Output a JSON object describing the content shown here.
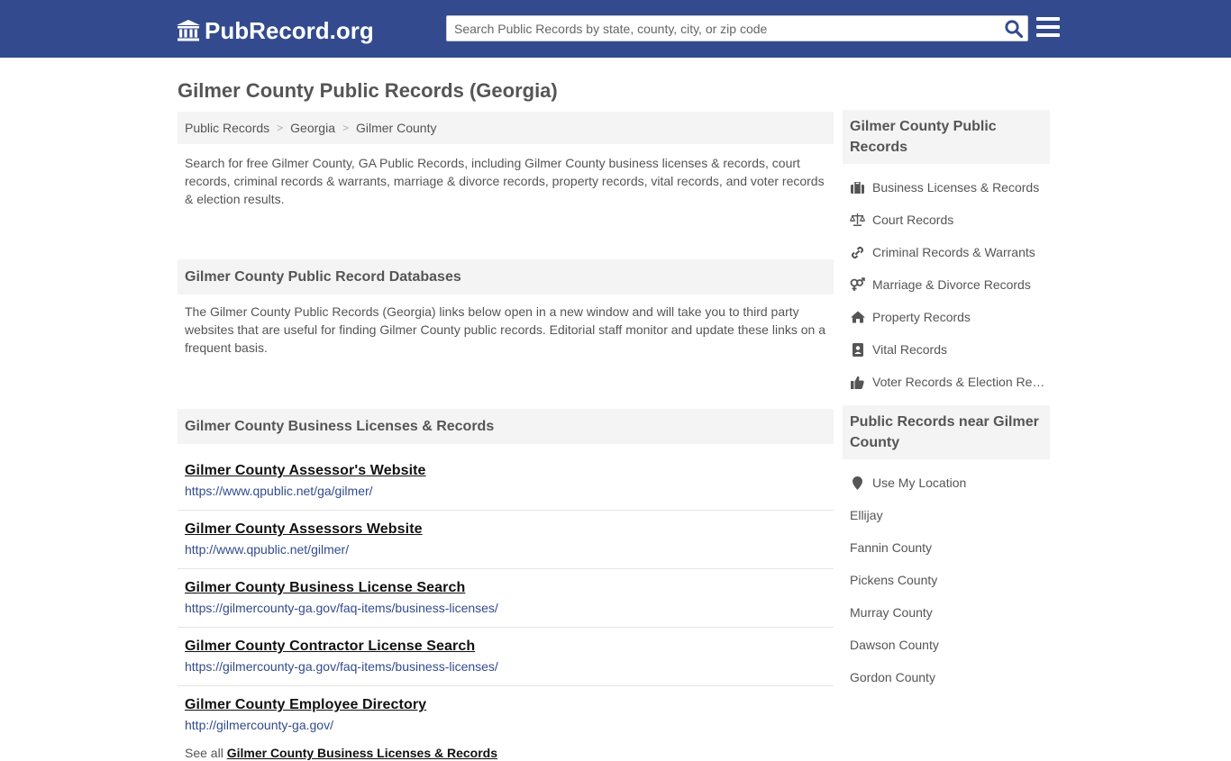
{
  "header": {
    "logo_text": "PubRecord.org",
    "search_placeholder": "Search Public Records by state, county, city, or zip code"
  },
  "page_title": "Gilmer County Public Records (Georgia)",
  "breadcrumb": [
    "Public Records",
    "Georgia",
    "Gilmer County"
  ],
  "intro": "Search for free Gilmer County, GA Public Records, including Gilmer County business licenses & records, court records, criminal records & warrants, marriage & divorce records, property records, vital records, and voter records & election results.",
  "databases": {
    "heading": "Gilmer County Public Record Databases",
    "description": "The Gilmer County Public Records (Georgia) links below open in a new window and will take you to third party websites that are useful for finding Gilmer County public records. Editorial staff monitor and update these links on a frequent basis."
  },
  "business": {
    "heading": "Gilmer County Business Licenses & Records",
    "records": [
      {
        "title": "Gilmer County Assessor's Website",
        "url": "https://www.qpublic.net/ga/gilmer/"
      },
      {
        "title": "Gilmer County Assessors Website",
        "url": "http://www.qpublic.net/gilmer/"
      },
      {
        "title": "Gilmer County Business License Search",
        "url": "https://gilmercounty-ga.gov/faq-items/business-licenses/"
      },
      {
        "title": "Gilmer County Contractor License Search",
        "url": "https://gilmercounty-ga.gov/faq-items/business-licenses/"
      },
      {
        "title": "Gilmer County Employee Directory",
        "url": "http://gilmercounty-ga.gov/"
      }
    ],
    "see_all_prefix": "See all",
    "see_all_link": "Gilmer County Business Licenses & Records"
  },
  "sidebar": {
    "records_heading": "Gilmer County Public Records",
    "records_links": [
      {
        "label": "Business Licenses & Records",
        "icon": "briefcase-icon"
      },
      {
        "label": "Court Records",
        "icon": "scales-icon"
      },
      {
        "label": "Criminal Records & Warrants",
        "icon": "link-icon"
      },
      {
        "label": "Marriage & Divorce Records",
        "icon": "gender-icon"
      },
      {
        "label": "Property Records",
        "icon": "home-icon"
      },
      {
        "label": "Vital Records",
        "icon": "id-card-icon"
      },
      {
        "label": "Voter Records & Election Results",
        "icon": "thumbs-up-icon"
      }
    ],
    "near_heading": "Public Records near Gilmer County",
    "use_location": "Use My Location",
    "near_links": [
      "Ellijay",
      "Fannin County",
      "Pickens County",
      "Murray County",
      "Dawson County",
      "Gordon County"
    ]
  },
  "colors": {
    "header_bg": "#334b8e",
    "link_url": "#334b8e",
    "panel_bg": "#f4f4f4"
  }
}
